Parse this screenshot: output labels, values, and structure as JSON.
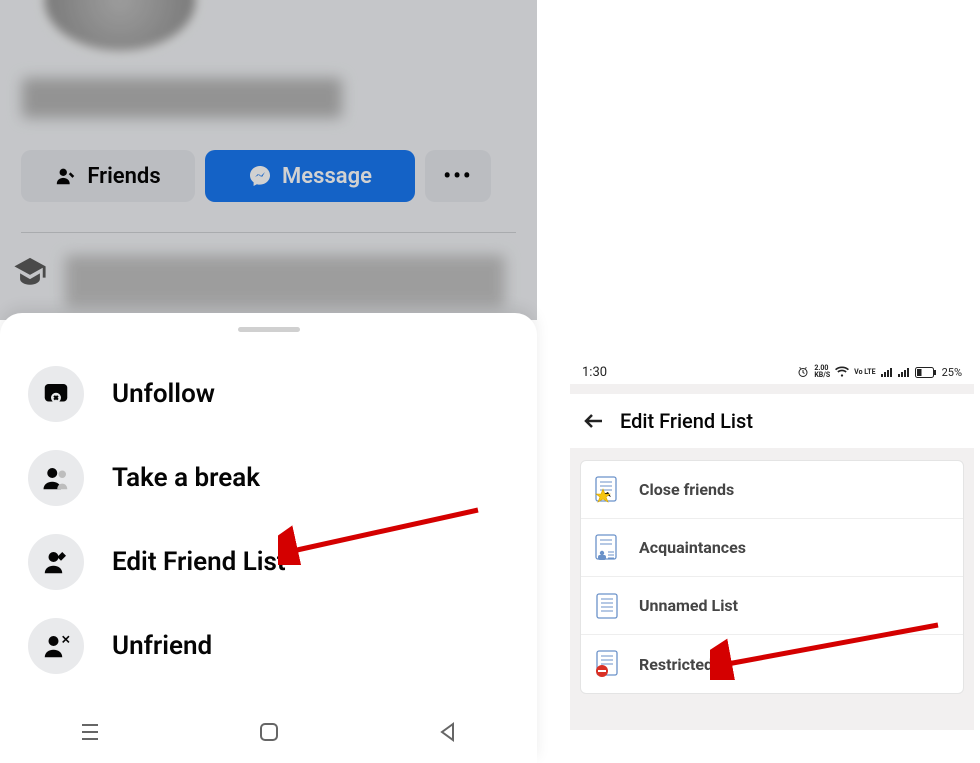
{
  "phone1": {
    "friends_label": "Friends",
    "message_label": "Message",
    "more_label": "•••",
    "sheet": {
      "unfollow": "Unfollow",
      "take_break": "Take a break",
      "edit_friend_list": "Edit Friend List",
      "unfriend": "Unfriend"
    }
  },
  "phone2": {
    "status": {
      "time": "1:30",
      "kbps": "2.00",
      "kbps_unit": "KB/S",
      "lte": "Vo LTE",
      "battery_pct": "25%"
    },
    "header": "Edit Friend List",
    "lists": {
      "close_friends": "Close friends",
      "acquaintances": "Acquaintances",
      "unnamed": "Unnamed List",
      "restricted": "Restricted"
    }
  }
}
